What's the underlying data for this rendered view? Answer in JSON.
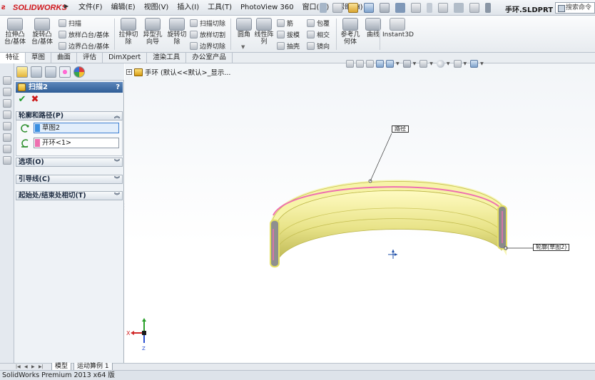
{
  "app": {
    "brand": "SOLIDWORKS",
    "document_title": "手环.SLDPRT *",
    "search_placeholder": "搜索命令"
  },
  "menu": [
    "文件(F)",
    "编辑(E)",
    "视图(V)",
    "插入(I)",
    "工具(T)",
    "PhotoView 360",
    "窗口(W)",
    "帮助(H)"
  ],
  "ribbon": {
    "extrude_boss": "拉伸凸\n台/基体",
    "revolve_boss": "旋转凸\n台/基体",
    "sweep": "扫描",
    "loft_boss": "放样凸台/基体",
    "boundary_boss": "边界凸台/基体",
    "extrude_cut": "拉伸切\n除",
    "hole_wizard": "异型孔\n向导",
    "revolve_cut": "旋转切\n除",
    "swept_cut": "扫描切除",
    "lofted_cut": "放样切割",
    "boundary_cut": "边界切除",
    "fillet": "圆角",
    "linear_pattern": "线性阵\n列",
    "rib": "筋",
    "draft": "拔模",
    "shell": "抽壳",
    "wrap": "包覆",
    "intersect": "相交",
    "mirror": "镜向",
    "ref_geometry": "参考几\n何体",
    "curves": "曲线",
    "instant3d": "Instant3D"
  },
  "tabs": [
    "特征",
    "草图",
    "曲面",
    "评估",
    "DimXpert",
    "渲染工具",
    "办公室产品"
  ],
  "tree": {
    "root_label": "手环  (默认<<默认>_显示..."
  },
  "property_manager": {
    "title": "扫描2",
    "help": "?",
    "ok_symbol": "✔",
    "cancel_symbol": "✖",
    "groups": {
      "profile_path": "轮廓和路径(P)",
      "options": "选项(O)",
      "guide_curves": "引导线(C)",
      "tangency": "起始处/结束处相切(T)"
    },
    "profile_value": "草图2",
    "path_value": "开环<1>",
    "profile_color": "#3a8ee0",
    "path_color": "#ee6fb0"
  },
  "callouts": {
    "path": "路径",
    "profile": "轮廓(草图2)"
  },
  "triad": {
    "x": "X",
    "z": "Z"
  },
  "bottom_tabs": {
    "model": "模型",
    "motion": "运动算例 1"
  },
  "status": "SolidWorks Premium 2013 x64 版",
  "colors": {
    "brand_red": "#d0161b",
    "highlight_yellow": "#f2ef55",
    "path_pink": "#ee6fb0"
  }
}
